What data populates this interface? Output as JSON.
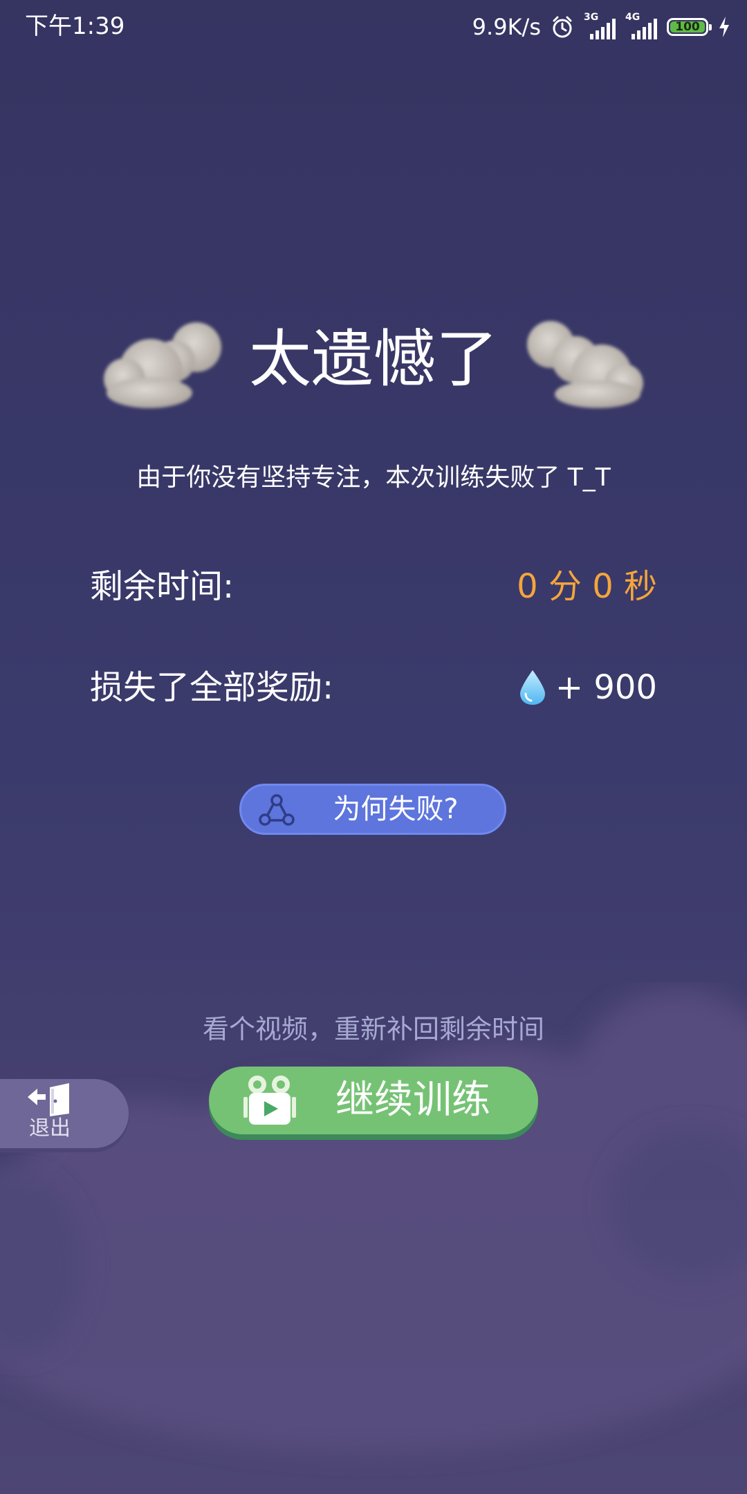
{
  "status_bar": {
    "time": "下午1:39",
    "net_speed": "9.9K/s",
    "signal_1_type": "3G",
    "signal_2_type": "4G",
    "battery_level": "100",
    "icons": [
      "alarm-icon",
      "signal-3g-icon",
      "signal-4g-icon",
      "battery-icon",
      "charging-icon"
    ]
  },
  "result": {
    "headline": "太遗憾了",
    "subtitle": "由于你没有坚持专注，本次训练失败了 T_T",
    "remaining_time_label": "剩余时间:",
    "remaining_time_value": "0 分 0 秒",
    "lost_reward_label": "损失了全部奖励:",
    "lost_reward_value": "+ 900",
    "reward_icon": "water-drop-icon",
    "why_button_label": "为何失败?"
  },
  "bottom": {
    "hint": "看个视频，重新补回剩余时间",
    "continue_label": "继续训练",
    "exit_label": "退出"
  },
  "colors": {
    "background": "#383666",
    "accent_orange": "#f4a53c",
    "why_button": "#5d75dc",
    "continue_button": "#76c275",
    "exit_button": "#6e6797",
    "hint_text": "#a7a9d2"
  }
}
